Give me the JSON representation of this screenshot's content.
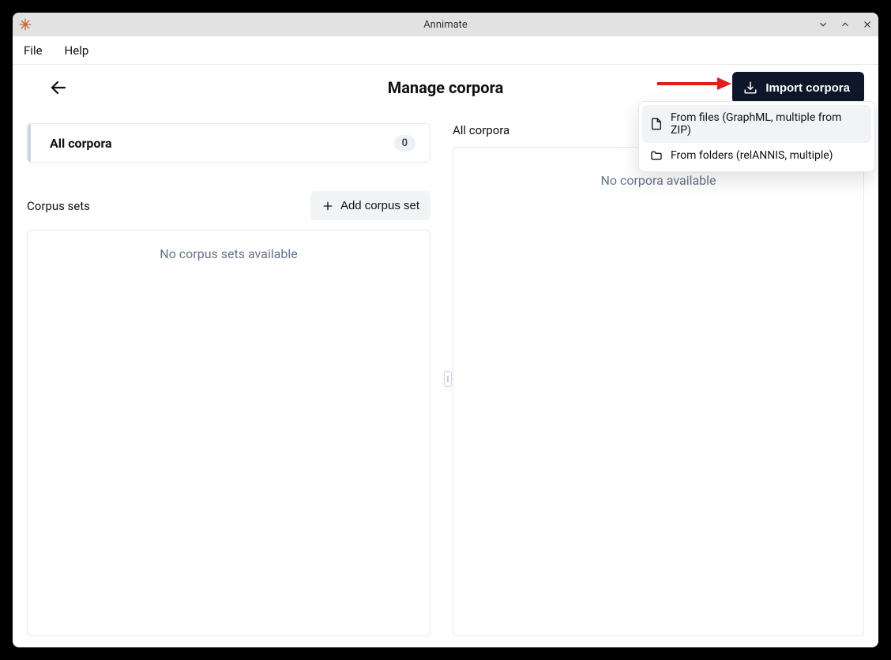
{
  "titlebar": {
    "title": "Annimate"
  },
  "menubar": {
    "file": "File",
    "help": "Help"
  },
  "header": {
    "page_title": "Manage corpora",
    "import_label": "Import corpora"
  },
  "dropdown": {
    "from_files": "From files (GraphML, multiple from ZIP)",
    "from_folders": "From folders (relANNIS, multiple)"
  },
  "left": {
    "all_corpora_label": "All corpora",
    "all_corpora_count": "0",
    "corpus_sets_label": "Corpus sets",
    "add_corpus_set_label": "Add corpus set",
    "no_sets_text": "No corpus sets available"
  },
  "right": {
    "all_corpora_label": "All corpora",
    "no_corpora_text": "No corpora available"
  },
  "colors": {
    "primary_dark": "#0f172a",
    "accent_arrow": "#e11d1d"
  }
}
